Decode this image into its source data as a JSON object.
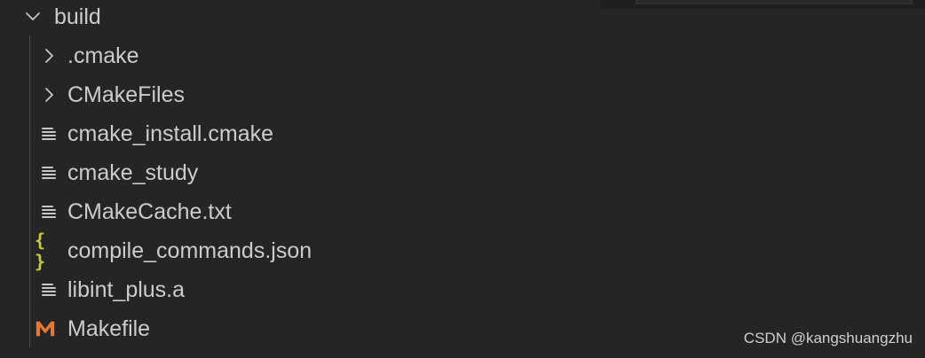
{
  "explorer": {
    "root": {
      "label": "build",
      "expanded": true,
      "icon": "chevron-down-icon"
    },
    "items": [
      {
        "label": ".cmake",
        "kind": "folder",
        "icon": "chevron-right-icon"
      },
      {
        "label": "CMakeFiles",
        "kind": "folder",
        "icon": "chevron-right-icon"
      },
      {
        "label": "cmake_install.cmake",
        "kind": "file",
        "icon": "lines-file-icon"
      },
      {
        "label": "cmake_study",
        "kind": "file",
        "icon": "lines-file-icon"
      },
      {
        "label": "CMakeCache.txt",
        "kind": "file",
        "icon": "lines-file-icon"
      },
      {
        "label": "compile_commands.json",
        "kind": "file",
        "icon": "json-braces-icon",
        "icon_text": "{ }",
        "icon_color": "#cbcb41"
      },
      {
        "label": "libint_plus.a",
        "kind": "file",
        "icon": "lines-file-icon"
      },
      {
        "label": "Makefile",
        "kind": "file",
        "icon": "makefile-m-icon",
        "icon_color": "#e37933"
      }
    ]
  },
  "watermark": {
    "text": "CSDN @kangshuangzhu"
  },
  "colors": {
    "background": "#252526",
    "text": "#cccccc",
    "icon": "#c5c5c5",
    "indent_guide": "#4a4a4a",
    "json_icon": "#cbcb41",
    "makefile_icon": "#e37933"
  }
}
